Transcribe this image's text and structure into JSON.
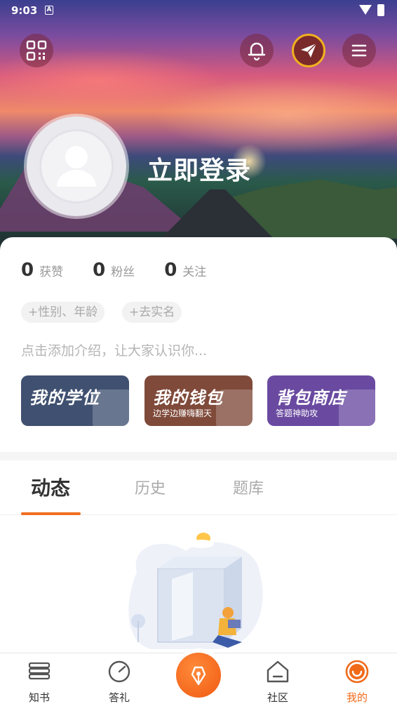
{
  "status_bar": {
    "time": "9:03",
    "a_label": "A"
  },
  "header": {
    "login_label": "立即登录"
  },
  "stats": [
    {
      "value": "0",
      "label": "获赞"
    },
    {
      "value": "0",
      "label": "粉丝"
    },
    {
      "value": "0",
      "label": "关注"
    }
  ],
  "tags": [
    "+性别、年龄",
    "+去实名"
  ],
  "intro_placeholder": "点击添加介绍，让大家认识你...",
  "promos": [
    {
      "title": "我的学位",
      "subtitle": ""
    },
    {
      "title": "我的钱包",
      "subtitle": "边学边赚嗨翻天"
    },
    {
      "title": "背包商店",
      "subtitle": "答题神助攻"
    }
  ],
  "tabs": [
    {
      "label": "动态",
      "active": true
    },
    {
      "label": "历史",
      "active": false
    },
    {
      "label": "题库",
      "active": false
    }
  ],
  "bottom_nav": [
    {
      "label": "知书",
      "icon": "books-icon",
      "active": false
    },
    {
      "label": "答礼",
      "icon": "gauge-icon",
      "active": false
    },
    {
      "label": "社区",
      "icon": "house-icon",
      "active": false
    },
    {
      "label": "我的",
      "icon": "smile-icon",
      "active": true
    }
  ],
  "colors": {
    "accent": "#f06a1a",
    "promo_blue": "#3f5070",
    "promo_brown": "#7f4a3a",
    "promo_purple": "#6a4aa0"
  }
}
